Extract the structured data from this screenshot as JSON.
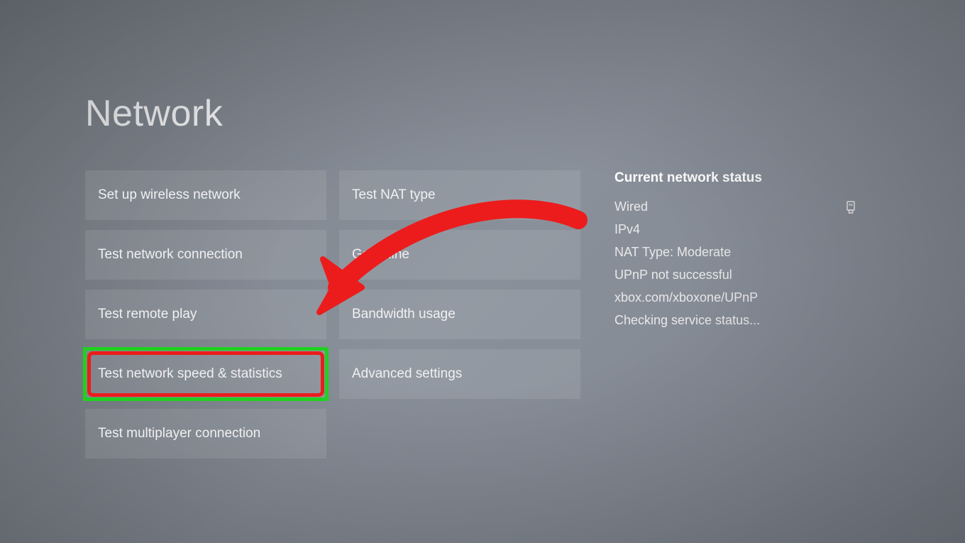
{
  "page": {
    "title": "Network"
  },
  "column_left": {
    "items": [
      {
        "label": "Set up wireless network",
        "highlighted": false
      },
      {
        "label": "Test network connection",
        "highlighted": false
      },
      {
        "label": "Test remote play",
        "highlighted": false
      },
      {
        "label": "Test network speed & statistics",
        "highlighted": true
      },
      {
        "label": "Test multiplayer connection",
        "highlighted": false
      }
    ]
  },
  "column_right": {
    "items": [
      {
        "label": "Test NAT type"
      },
      {
        "label": "Go offline"
      },
      {
        "label": "Bandwidth usage"
      },
      {
        "label": "Advanced settings"
      }
    ]
  },
  "status": {
    "title": "Current network status",
    "lines": [
      {
        "text": "Wired",
        "icon": "ethernet-icon"
      },
      {
        "text": "IPv4"
      },
      {
        "text": "NAT Type: Moderate"
      },
      {
        "text": "UPnP not successful"
      },
      {
        "text": "xbox.com/xboxone/UPnP"
      },
      {
        "text": "Checking service status..."
      }
    ]
  },
  "annotation": {
    "arrow_color": "#ec1c1c",
    "highlight_color": "#20d020"
  }
}
